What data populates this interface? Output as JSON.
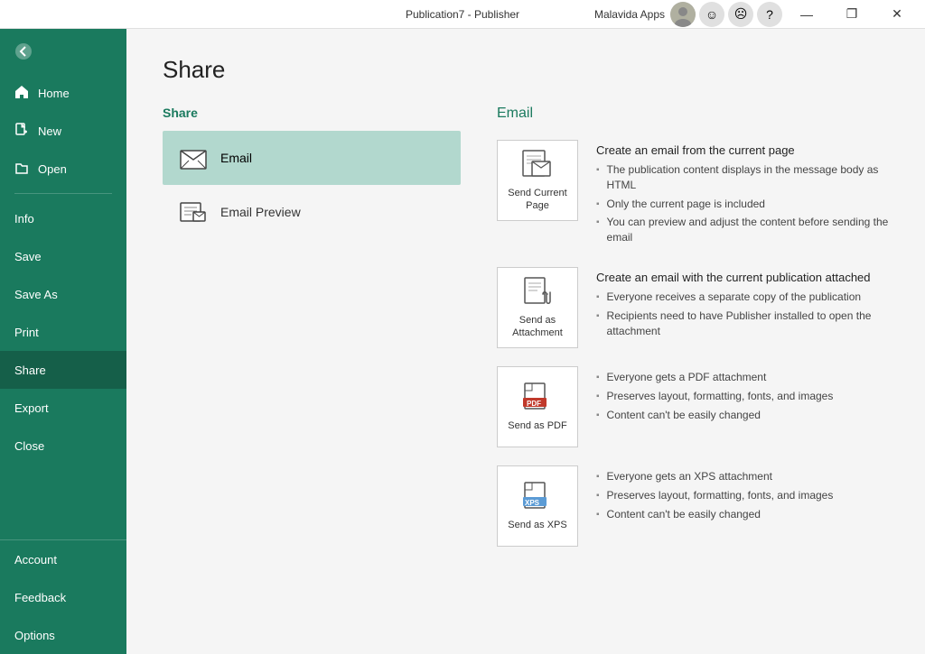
{
  "titlebar": {
    "app_title": "Publication7 - Publisher",
    "user_name": "Malavida Apps",
    "btn_minimize": "—",
    "btn_restore": "❐",
    "btn_close": "✕",
    "btn_help": "?",
    "btn_smiley": "☺",
    "btn_frown": "☹"
  },
  "sidebar": {
    "back_label": "",
    "items_top": [
      {
        "label": "Home",
        "icon": "🏠",
        "id": "home"
      },
      {
        "label": "New",
        "icon": "📄",
        "id": "new"
      },
      {
        "label": "Open",
        "icon": "📂",
        "id": "open"
      }
    ],
    "items_mid": [
      {
        "label": "Info",
        "icon": "",
        "id": "info"
      },
      {
        "label": "Save",
        "icon": "",
        "id": "save"
      },
      {
        "label": "Save As",
        "icon": "",
        "id": "save-as"
      },
      {
        "label": "Print",
        "icon": "",
        "id": "print"
      },
      {
        "label": "Share",
        "icon": "",
        "id": "share",
        "active": true
      },
      {
        "label": "Export",
        "icon": "",
        "id": "export"
      },
      {
        "label": "Close",
        "icon": "",
        "id": "close"
      }
    ],
    "items_bottom": [
      {
        "label": "Account",
        "icon": "",
        "id": "account"
      },
      {
        "label": "Feedback",
        "icon": "",
        "id": "feedback"
      },
      {
        "label": "Options",
        "icon": "",
        "id": "options"
      }
    ]
  },
  "main": {
    "title": "Share",
    "share_section_label": "Share",
    "email_section_label": "Email",
    "share_options": [
      {
        "id": "email",
        "label": "Email",
        "active": true
      },
      {
        "id": "email-preview",
        "label": "Email Preview",
        "active": false
      }
    ],
    "email_options": [
      {
        "id": "send-current-page",
        "label": "Send Current\nPage",
        "card_label": "Send Current Page",
        "title": "Create an email from the current page",
        "bullets": [
          "The publication content displays in the message body as HTML",
          "Only the current page is included",
          "You can preview and adjust the content before sending the email"
        ]
      },
      {
        "id": "send-as-attachment",
        "label": "Send as\nAttachment",
        "card_label": "Send as Attachment",
        "title": "Create an email with the current publication attached",
        "bullets": [
          "Everyone receives a separate copy of the publication",
          "Recipients need to have Publisher installed to open the attachment"
        ]
      },
      {
        "id": "send-as-pdf",
        "label": "Send as PDF",
        "card_label": "Send as PDF",
        "title": "",
        "bullets": [
          "Everyone gets a PDF attachment",
          "Preserves layout, formatting, fonts, and images",
          "Content can't be easily changed"
        ]
      },
      {
        "id": "send-as-xps",
        "label": "Send as XPS",
        "card_label": "Send as XPS",
        "title": "",
        "bullets": [
          "Everyone gets an XPS attachment",
          "Preserves layout, formatting, fonts, and images",
          "Content can't be easily changed"
        ]
      }
    ]
  }
}
